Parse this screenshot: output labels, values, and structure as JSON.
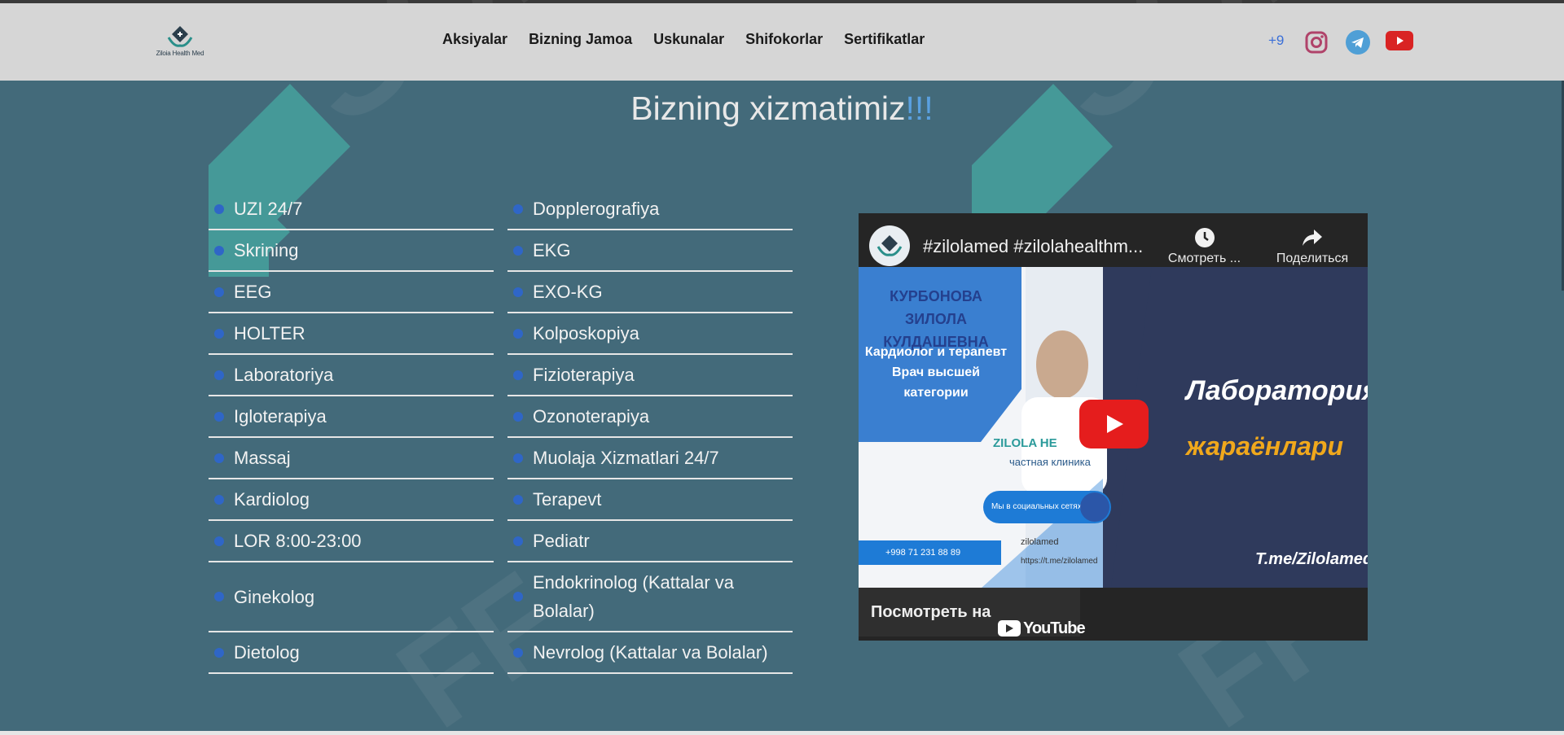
{
  "brand": {
    "logo_text": "Ziloia Health Med"
  },
  "nav": {
    "items": [
      "Aksiyalar",
      "Bizning Jamoa",
      "Uskunalar",
      "Shifokorlar",
      "Sertifikatlar"
    ]
  },
  "header": {
    "phone": "+9"
  },
  "social": [
    "instagram-icon",
    "telegram-icon",
    "youtube-icon"
  ],
  "section": {
    "title": "Bizning xizmatimiz",
    "title_accent": "!!!"
  },
  "services": {
    "left": [
      "UZI 24/7",
      "Skrining",
      "EEG",
      "HOLTER",
      "Laboratoriya",
      "Igloterapiya",
      "Massaj",
      "Kardiolog",
      "LOR 8:00-23:00",
      "Ginekolog",
      "Dietolog"
    ],
    "right": [
      "Dopplerografiya",
      "EKG",
      "EXO-KG",
      "Kolposkopiya",
      "Fizioterapiya",
      "Ozonoterapiya",
      "Muolaja Xizmatlari 24/7",
      "Terapevt",
      "Pediatr",
      "Endokrinolog (Kattalar va Bolalar)",
      "Nevrolog (Kattalar va Bolalar)"
    ]
  },
  "video": {
    "title": "#zilolamed #zilolahealthm...",
    "watch_later": "Смотреть ...",
    "share": "Поделиться",
    "watch_on": "Посмотреть на",
    "youtube_word": "YouTube",
    "thumb": {
      "name_line1": "КУРБОНОВА ЗИЛОЛА",
      "name_line2": "КУЛДАШЕВНА",
      "role_line1": "Кардиолог и терапевт",
      "role_line2": "Врач высшей",
      "role_line3": "категории",
      "clinic": "ZILOLA HE",
      "clinic_sub": "частная клиника",
      "social": "Мы в социальных сетях",
      "phone": "+998 71 231 88 89",
      "handle": "zilolamed",
      "url": "https://t.me/zilolamed",
      "lab": "Лаборатория",
      "process": "жараёнлари",
      "tme": "T.me/Zilolamed"
    }
  },
  "colors": {
    "background": "#436a7a",
    "header": "#d6d6d6",
    "accent": "#5aa0e0",
    "dot": "#2f66c7"
  }
}
